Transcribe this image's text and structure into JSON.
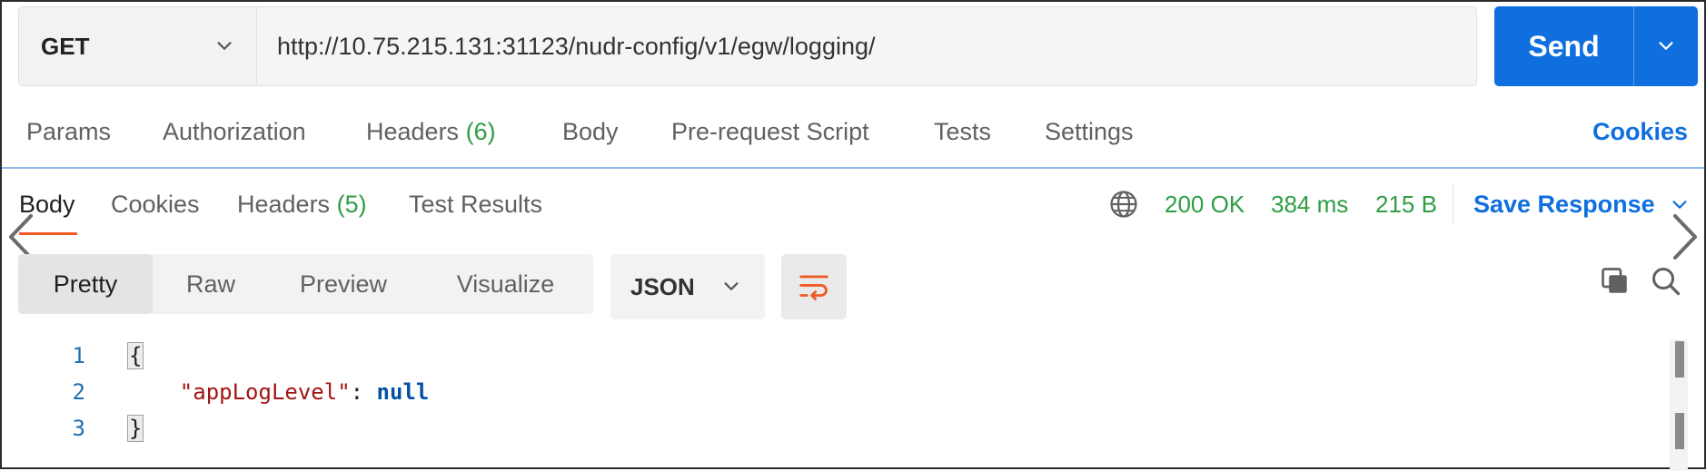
{
  "request": {
    "method": "GET",
    "url": "http://10.75.215.131:31123/nudr-config/v1/egw/logging/",
    "send_label": "Send"
  },
  "request_tabs": {
    "params": "Params",
    "authorization": "Authorization",
    "headers": "Headers",
    "headers_count": "(6)",
    "body": "Body",
    "pre_request": "Pre-request Script",
    "tests": "Tests",
    "settings": "Settings",
    "cookies": "Cookies"
  },
  "response_tabs": {
    "body": "Body",
    "cookies": "Cookies",
    "headers": "Headers",
    "headers_count": "(5)",
    "test_results": "Test Results"
  },
  "response_status": {
    "status": "200 OK",
    "time": "384 ms",
    "size": "215 B",
    "save_response": "Save Response"
  },
  "format_toolbar": {
    "pretty": "Pretty",
    "raw": "Raw",
    "preview": "Preview",
    "visualize": "Visualize",
    "language": "JSON"
  },
  "code": {
    "line_numbers": [
      "1",
      "2",
      "3"
    ],
    "open_brace": "{",
    "key": "\"appLogLevel\"",
    "colon": ": ",
    "value": "null",
    "close_brace": "}"
  },
  "colors": {
    "accent": "#0f6fde",
    "status_green": "#2f9e44",
    "active_tab_underline": "#ef5b25"
  },
  "icons": {
    "method_dropdown": "chevron-down-icon",
    "send_dropdown": "chevron-down-icon",
    "globe": "globe-icon",
    "wrap": "wrap-lines-icon",
    "copy": "copy-icon",
    "search": "search-icon"
  }
}
